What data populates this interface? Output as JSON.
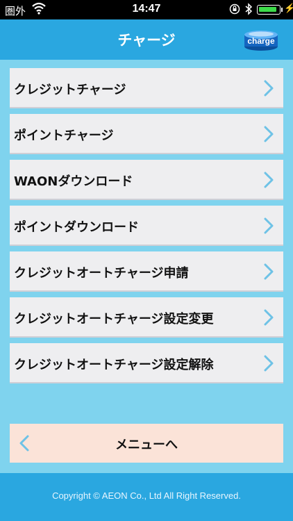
{
  "status_bar": {
    "carrier": "圏外",
    "time": "14:47",
    "battery_level": 0.92
  },
  "header": {
    "title": "チャージ",
    "badge_text": "charge"
  },
  "menu": {
    "items": [
      {
        "label": "クレジットチャージ"
      },
      {
        "label": "ポイントチャージ"
      },
      {
        "label": "WAONダウンロード"
      },
      {
        "label": "ポイントダウンロード"
      },
      {
        "label": "クレジットオートチャージ申請"
      },
      {
        "label": "クレジットオートチャージ設定変更"
      },
      {
        "label": "クレジットオートチャージ設定解除"
      }
    ]
  },
  "back": {
    "label": "メニューへ"
  },
  "footer": {
    "copyright": "Copyright © AEON Co., Ltd All Right Reserved."
  },
  "colors": {
    "header_bg": "#2aa7e0",
    "page_bg": "#7fd3ee",
    "item_bg": "#eeeef0",
    "back_bg": "#fbe3d8",
    "chevron": "#6ec2e6"
  }
}
